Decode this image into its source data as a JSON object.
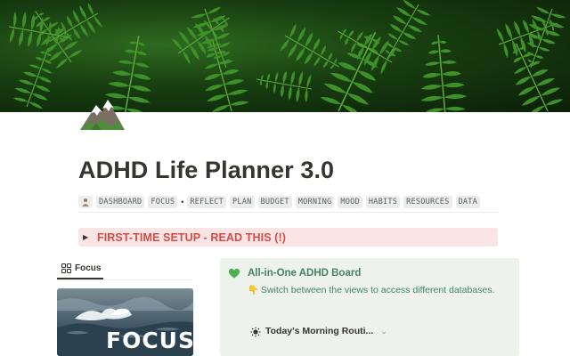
{
  "cover": {
    "description_icon": "fern-leaves-cover"
  },
  "page": {
    "icon": "mountain-icon",
    "title": "ADHD Life Planner 3.0"
  },
  "nav": {
    "emoji_icon": "person-icon",
    "items": [
      "DASHBOARD",
      "FOCUS",
      "•",
      "REFLECT",
      "PLAN",
      "BUDGET",
      "MORNING",
      "MOOD",
      "HABITS",
      "RESOURCES",
      "DATA"
    ]
  },
  "setup_callout": {
    "toggle_icon": "triangle-right-icon",
    "text": "FIRST-TIME SETUP - READ THIS (!)",
    "color": "#d44c47",
    "background": "#fbe4e4"
  },
  "focus_section": {
    "tab_icon": "grid-icon",
    "tab_label": "Focus",
    "card_word": "FOCUS"
  },
  "board_callout": {
    "icon": "green-heart-icon",
    "title": "All-in-One ADHD Board",
    "hint_icon": "pointing-down-hand-icon",
    "hint": "Switch between the views to access different databases.",
    "routine_icon": "sun-icon",
    "routine_label": "Today's Morning Routi...",
    "routine_chevron": "chevron-down-icon",
    "background": "#edf3ec",
    "accent": "#448361"
  }
}
